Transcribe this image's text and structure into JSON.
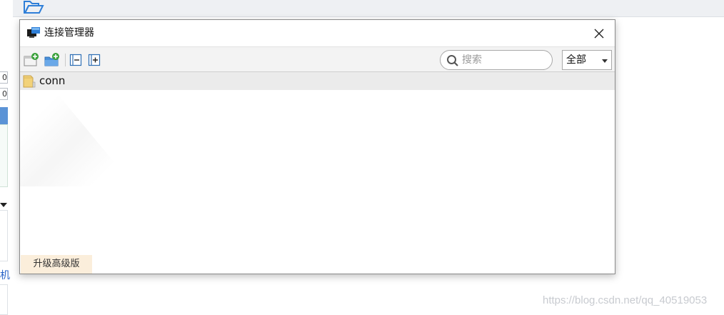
{
  "dialog": {
    "title": "连接管理器",
    "close_icon": "close-icon"
  },
  "toolbar": {
    "buttons": [
      {
        "name": "new-connection-button",
        "icon": "new-connection-icon"
      },
      {
        "name": "new-group-button",
        "icon": "new-folder-icon"
      },
      {
        "name": "collapse-all-button",
        "icon": "collapse-icon"
      },
      {
        "name": "expand-all-button",
        "icon": "expand-icon"
      }
    ],
    "search": {
      "placeholder": "搜索",
      "value": ""
    },
    "filter": {
      "selected": "全部"
    }
  },
  "tree": {
    "items": [
      {
        "label": "conn",
        "icon": "folder-icon",
        "selected": true
      }
    ]
  },
  "footer": {
    "upgrade_label": "升级高级版"
  },
  "background": {
    "left_digits": [
      "0",
      "0"
    ],
    "left_char": "机",
    "watermark": "https://blog.csdn.net/qq_40519053"
  },
  "colors": {
    "selection": "#ebebeb",
    "upgrade_bg": "#fbeedb",
    "accent_blue": "#2f7fd8",
    "icon_green": "#3aa13a"
  }
}
